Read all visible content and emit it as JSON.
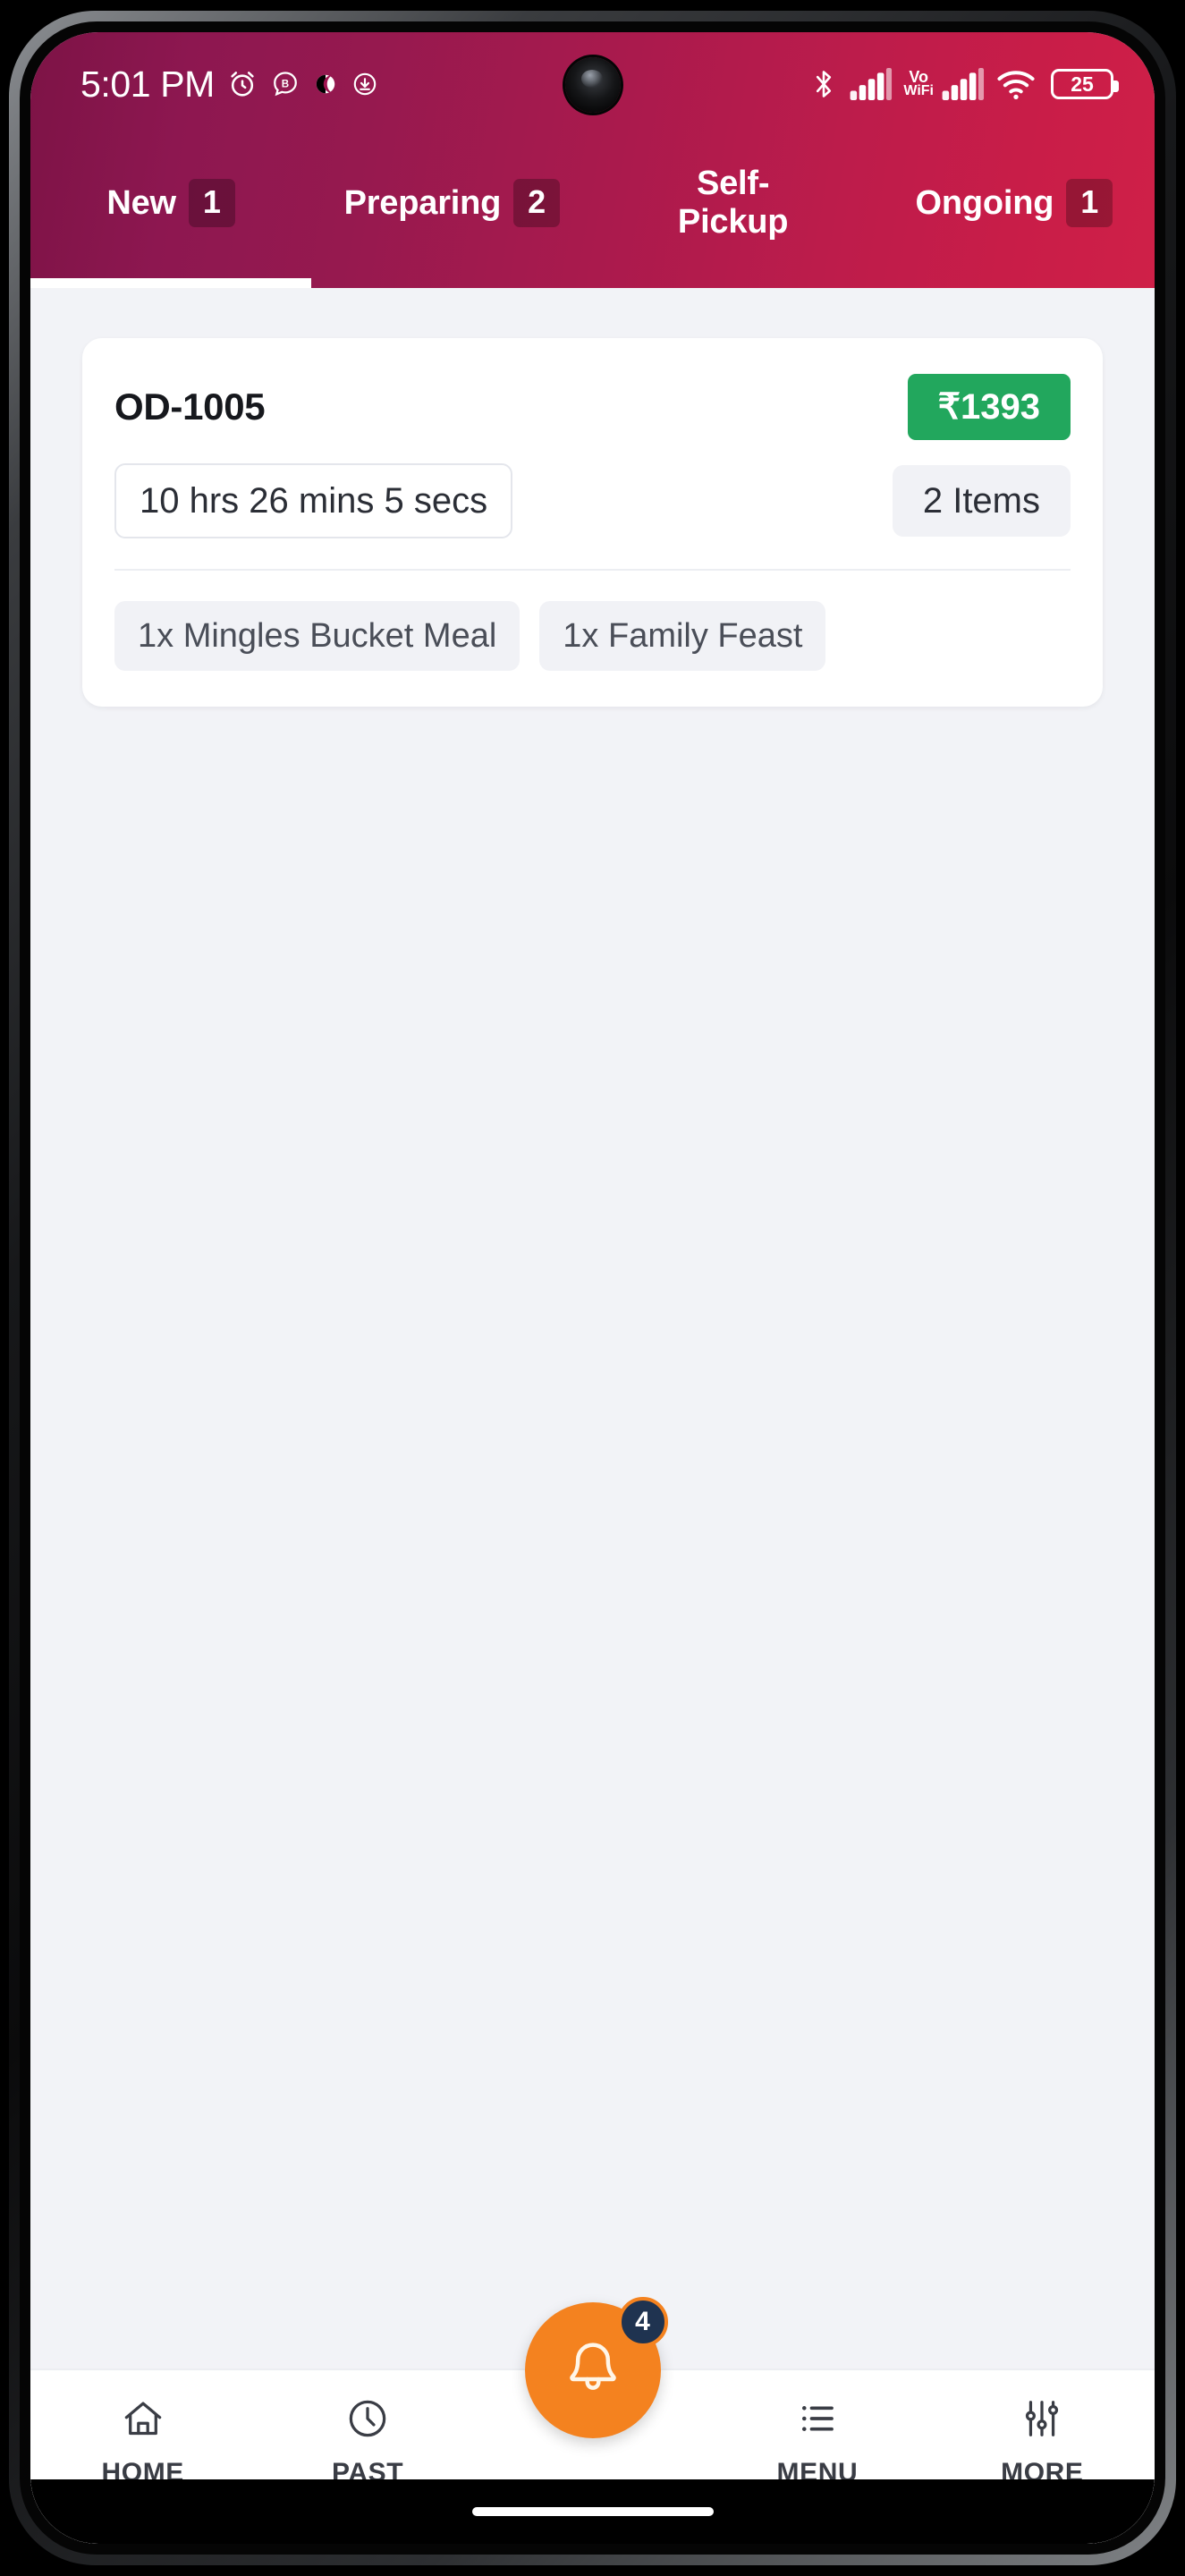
{
  "status_bar": {
    "time": "5:01 PM",
    "left_icons": [
      "alarm-icon",
      "b-circle-icon",
      "moon-icon",
      "download-circle-icon"
    ],
    "right_icons": [
      "bluetooth-icon",
      "signal-bars-icon",
      "signal-bars-icon",
      "wifi-icon"
    ],
    "vowifi_top": "Vo",
    "vowifi_bottom": "WiFi",
    "battery_level": "25"
  },
  "tabs": [
    {
      "label": "New",
      "badge": "1",
      "active": true
    },
    {
      "label": "Preparing",
      "badge": "2",
      "active": false
    },
    {
      "label": "Self-Pickup",
      "badge": "",
      "active": false
    },
    {
      "label": "Ongoing",
      "badge": "1",
      "active": false
    }
  ],
  "order": {
    "id": "OD-1005",
    "amount": "₹1393",
    "elapsed": "10 hrs 26 mins 5 secs",
    "items_count": "2 Items",
    "items": [
      "1x Mingles Bucket Meal",
      "1x Family Feast"
    ]
  },
  "bottom_nav": {
    "items": [
      {
        "label": "HOME",
        "icon": "home-icon"
      },
      {
        "label": "PAST",
        "icon": "clock-icon"
      },
      {
        "label": "MENU",
        "icon": "list-icon"
      },
      {
        "label": "MORE",
        "icon": "sliders-icon"
      }
    ],
    "fab": {
      "icon": "bell-icon",
      "badge": "4"
    }
  },
  "colors": {
    "header_gradient_start": "#7d1346",
    "header_gradient_end": "#cf2048",
    "amount_green": "#22a75d",
    "fab_orange": "#f4821f",
    "badge_navy": "#1f3350",
    "page_bg": "#f2f3f7"
  }
}
